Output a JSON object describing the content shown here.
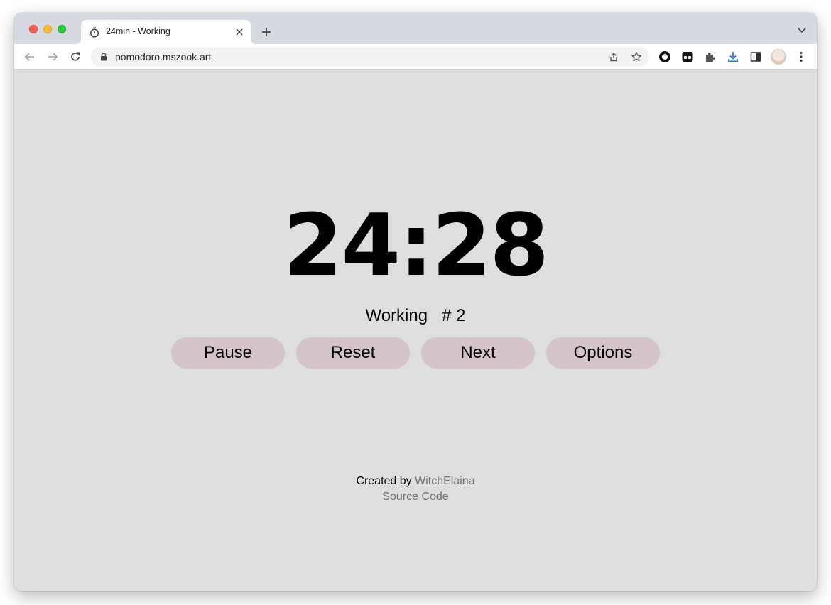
{
  "browser": {
    "tab": {
      "title": "24min - Working",
      "icon": "stopwatch-icon"
    },
    "url": "pomodoro.mszook.art"
  },
  "timer": {
    "display": "24:28",
    "mode_label": "Working",
    "session": "# 2"
  },
  "controls": {
    "pause_label": "Pause",
    "reset_label": "Reset",
    "next_label": "Next",
    "options_label": "Options"
  },
  "footer": {
    "created_by_prefix": "Created by",
    "author": "WitchElaina",
    "source_code_label": "Source Code"
  },
  "colors": {
    "page_background": "#dedede",
    "button_background": "#d4c3c9",
    "link_color": "#707070",
    "tabstrip_background": "#d6d9df"
  }
}
